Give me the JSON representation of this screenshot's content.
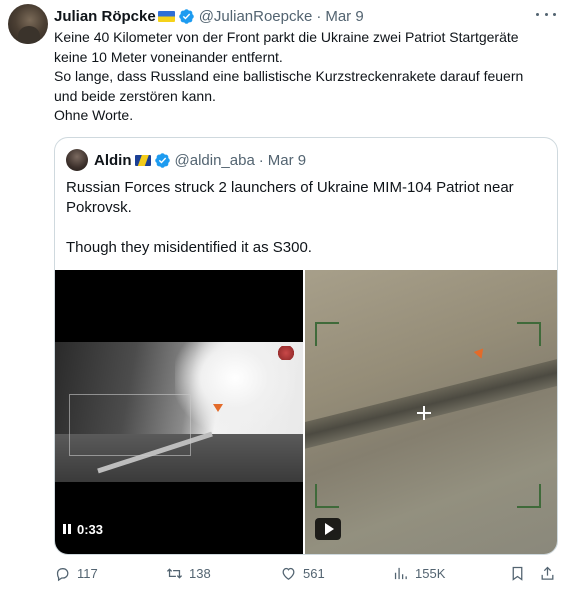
{
  "tweet": {
    "author_name": "Julian Röpcke",
    "author_handle": "@JulianRoepcke",
    "date": "Mar 9",
    "separator": "·",
    "text_lines": [
      "Keine 40 Kilometer von der Front parkt die Ukraine zwei Patriot Startgeräte",
      "keine 10 Meter voneinander entfernt.",
      "So lange, dass Russland eine ballistische Kurzstreckenrakete darauf feuern",
      "und beide zerstören kann.",
      "Ohne Worte."
    ]
  },
  "quote": {
    "author_name": "Aldin",
    "author_handle": "@aldin_aba",
    "date": "Mar 9",
    "separator": "·",
    "text_lines": [
      "Russian Forces struck 2 launchers of Ukraine MIM-104 Patriot near",
      "Pokrovsk.",
      "",
      "Though they misidentified it as S300."
    ],
    "video1": {
      "duration": "0:33",
      "control": "pause-icon"
    },
    "video2": {
      "control": "play-icon"
    }
  },
  "actions": {
    "replies": "117",
    "reposts": "138",
    "likes": "561",
    "views": "155K"
  },
  "colors": {
    "verified": "#1d9bf0",
    "muted": "#536471",
    "border": "#cfd9de",
    "marker": "#e36b2a"
  }
}
